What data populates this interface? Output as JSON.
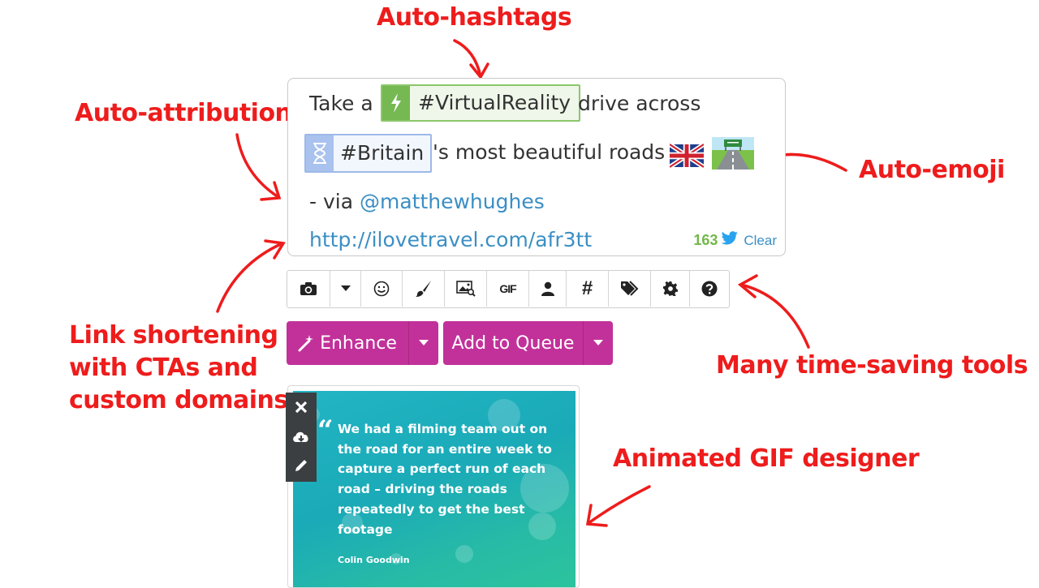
{
  "callouts": {
    "hashtags": "Auto-hashtags",
    "attribution": "Auto-attribution",
    "emoji": "Auto-emoji",
    "link_line1": "Link shortening",
    "link_line2": "with CTAs and",
    "link_line3": "custom domains",
    "tools": "Many time-saving tools",
    "gif": "Animated GIF designer"
  },
  "composer": {
    "line1_prefix": "Take a",
    "hashtag1": "#VirtualReality",
    "line1_suffix": "drive across",
    "hashtag2": "#Britain",
    "line2_suffix": "'s most beautiful roads",
    "emoji": [
      "🇬🇧",
      "🛣️"
    ],
    "via_prefix": "- via",
    "via_handle": "@matthewhughes",
    "short_link": "http://ilovetravel.com/afr3tt",
    "char_count": "163",
    "clear_label": "Clear"
  },
  "toolbar": {
    "buttons": [
      {
        "name": "camera-icon"
      },
      {
        "name": "caret-down-icon"
      },
      {
        "name": "smiley-icon"
      },
      {
        "name": "brush-icon"
      },
      {
        "name": "image-search-icon"
      },
      {
        "name": "gif-search-icon",
        "label": "GIF"
      },
      {
        "name": "user-icon"
      },
      {
        "name": "hashtag-icon",
        "label": "#"
      },
      {
        "name": "tags-icon"
      },
      {
        "name": "gear-icon"
      },
      {
        "name": "help-icon"
      }
    ]
  },
  "actions": {
    "enhance_label": "Enhance",
    "queue_label": "Add to Queue"
  },
  "gif_card": {
    "quote": "We had a filming team out on the road for an entire week to capture a perfect run of each road – driving the roads repeatedly to get the best footage",
    "author": "Colin Goodwin",
    "tools": [
      "close-icon",
      "cloud-download-icon",
      "pencil-icon"
    ]
  },
  "colors": {
    "callout": "#ee1c1c",
    "action": "#c2319a",
    "link": "#3b8fc4",
    "count": "#72b84a",
    "tag_green": "#76b852",
    "tag_blue": "#a9c2ee"
  }
}
